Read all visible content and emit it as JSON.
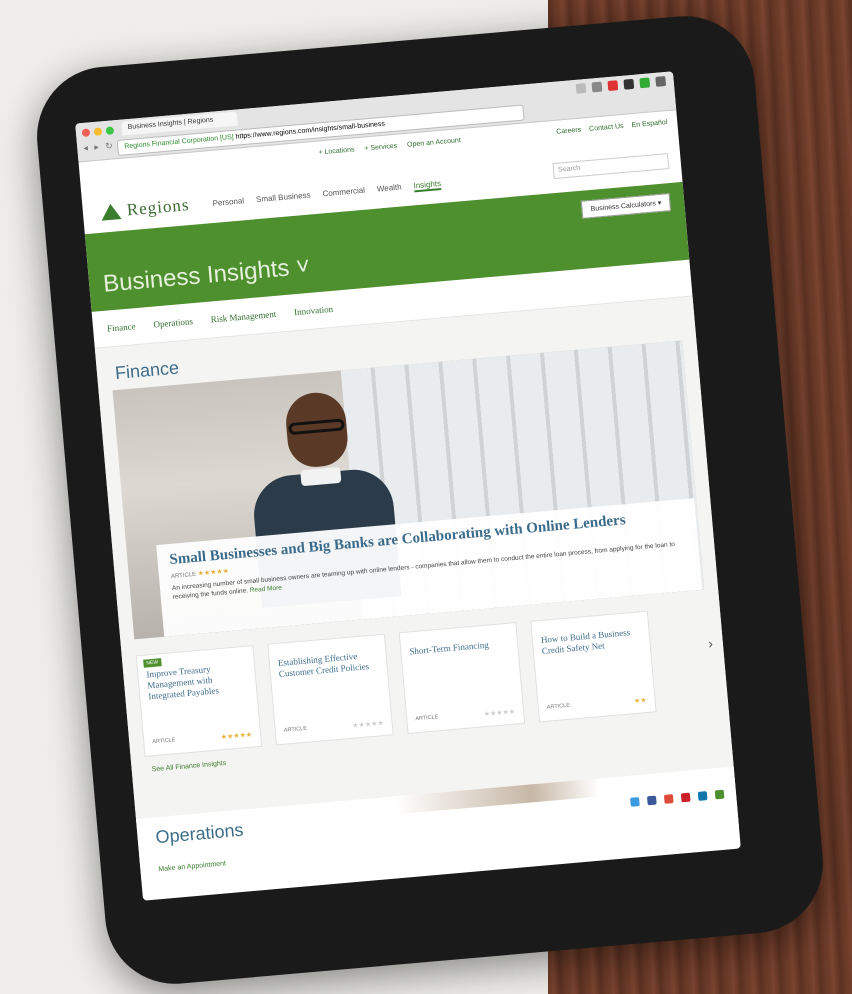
{
  "browser": {
    "tab_title": "Business Insights | Regions",
    "secure_label": "Regions Financial Corporation [US]",
    "url": "https://www.regions.com/insights/small-business",
    "nav_buttons": "◂ ▸ ↻"
  },
  "site": {
    "utility_links": [
      "+ Locations",
      "+ Services",
      "Open an Account"
    ],
    "utility_right": [
      "Careers",
      "Contact Us",
      "En Español"
    ],
    "logo_text": "Regions",
    "nav": [
      "Personal",
      "Small Business",
      "Commercial",
      "Wealth",
      "Insights"
    ],
    "search_placeholder": "Search",
    "banner_title": "Business Insights ˅",
    "calculator_button": "Business Calculators ▾",
    "subnav": [
      "Finance",
      "Operations",
      "Risk Management",
      "Innovation"
    ]
  },
  "finance": {
    "section_title": "Finance",
    "feature": {
      "title": "Small Businesses and Big Banks are Collaborating with Online Lenders",
      "type": "ARTICLE",
      "stars": "★★★★★",
      "summary": "An increasing number of small business owners are teaming up with online lenders - companies that allow them to conduct the entire loan process, from applying for the loan to receiving the funds online.",
      "read_more": "Read More"
    },
    "cards": [
      {
        "badge": "NEW",
        "title": "Improve Treasury Management with Integrated Payables",
        "type": "ARTICLE",
        "stars": "★★★★★"
      },
      {
        "badge": "",
        "title": "Establishing Effective Customer Credit Policies",
        "type": "ARTICLE",
        "stars": "★★★★★"
      },
      {
        "badge": "",
        "title": "Short-Term Financing",
        "type": "ARTICLE",
        "stars": "★★★★★"
      },
      {
        "badge": "",
        "title": "How to Build a Business Credit Safety Net",
        "type": "ARTICLE",
        "stars": "★★"
      }
    ],
    "see_all": "See All Finance Insights"
  },
  "operations": {
    "section_title": "Operations",
    "appointment": "Make an Appointment"
  },
  "colors": {
    "brand_green": "#4e8f2e",
    "title_blue": "#3e6d8a"
  }
}
